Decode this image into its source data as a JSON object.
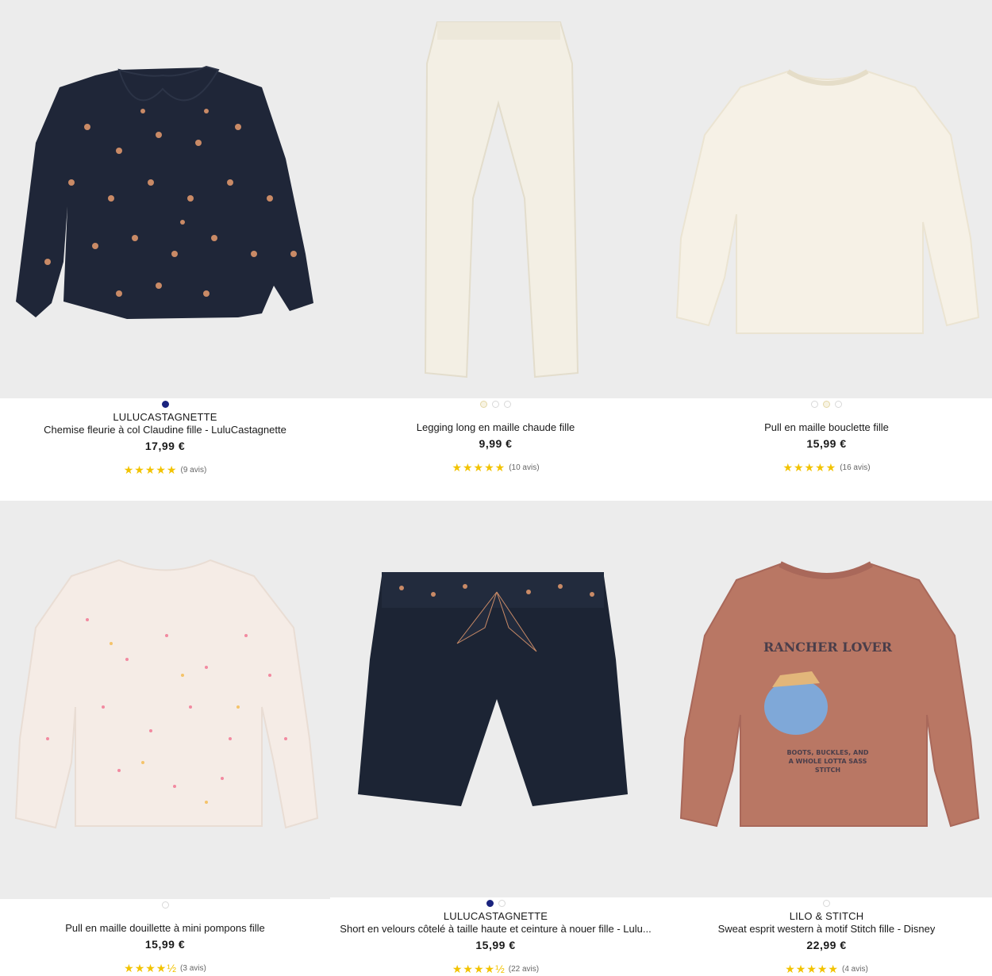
{
  "products": [
    {
      "brand": "LULUCASTAGNETTE",
      "name": "Chemise fleurie à col Claudine fille - LuluCastagnette",
      "price": "17,99 €",
      "stars": "★★★★★",
      "reviews": "(9 avis)",
      "swatches": [
        "navy"
      ],
      "image": "floral-blouse-image"
    },
    {
      "brand": "",
      "name": "Legging long en maille chaude fille",
      "price": "9,99 €",
      "stars": "★★★★★",
      "reviews": "(10 avis)",
      "swatches": [
        "cream",
        "white",
        "white"
      ],
      "image": "legging-image"
    },
    {
      "brand": "",
      "name": "Pull en maille bouclette fille",
      "price": "15,99 €",
      "stars": "★★★★★",
      "reviews": "(16 avis)",
      "swatches": [
        "white",
        "cream",
        "white"
      ],
      "image": "boucle-sweater-image"
    },
    {
      "brand": "",
      "name": "Pull en maille douillette à mini pompons fille",
      "price": "15,99 €",
      "stars": "★★★★½",
      "reviews": "(3 avis)",
      "swatches": [
        "white"
      ],
      "image": "pompom-sweater-image"
    },
    {
      "brand": "LULUCASTAGNETTE",
      "name": "Short en velours côtelé à taille haute et ceinture à nouer fille - Lulu...",
      "price": "15,99 €",
      "stars": "★★★★½",
      "reviews": "(22 avis)",
      "swatches": [
        "navy",
        "white"
      ],
      "image": "corduroy-shorts-image"
    },
    {
      "brand": "LILO & STITCH",
      "name": "Sweat esprit western à motif Stitch fille - Disney",
      "price": "22,99 €",
      "stars": "★★★★★",
      "reviews": "(4 avis)",
      "swatches": [
        "white"
      ],
      "image": "stitch-sweatshirt-image"
    }
  ],
  "print": {
    "rancher": "RANCHER LOVER",
    "tagline1": "BOOTS, BUCKLES, AND",
    "tagline2": "A WHOLE LOTTA SASS",
    "tagline3": "STITCH"
  },
  "colors": {
    "star": "#f2c300",
    "navy": "#1a237e",
    "bg_image": "#ececec"
  }
}
